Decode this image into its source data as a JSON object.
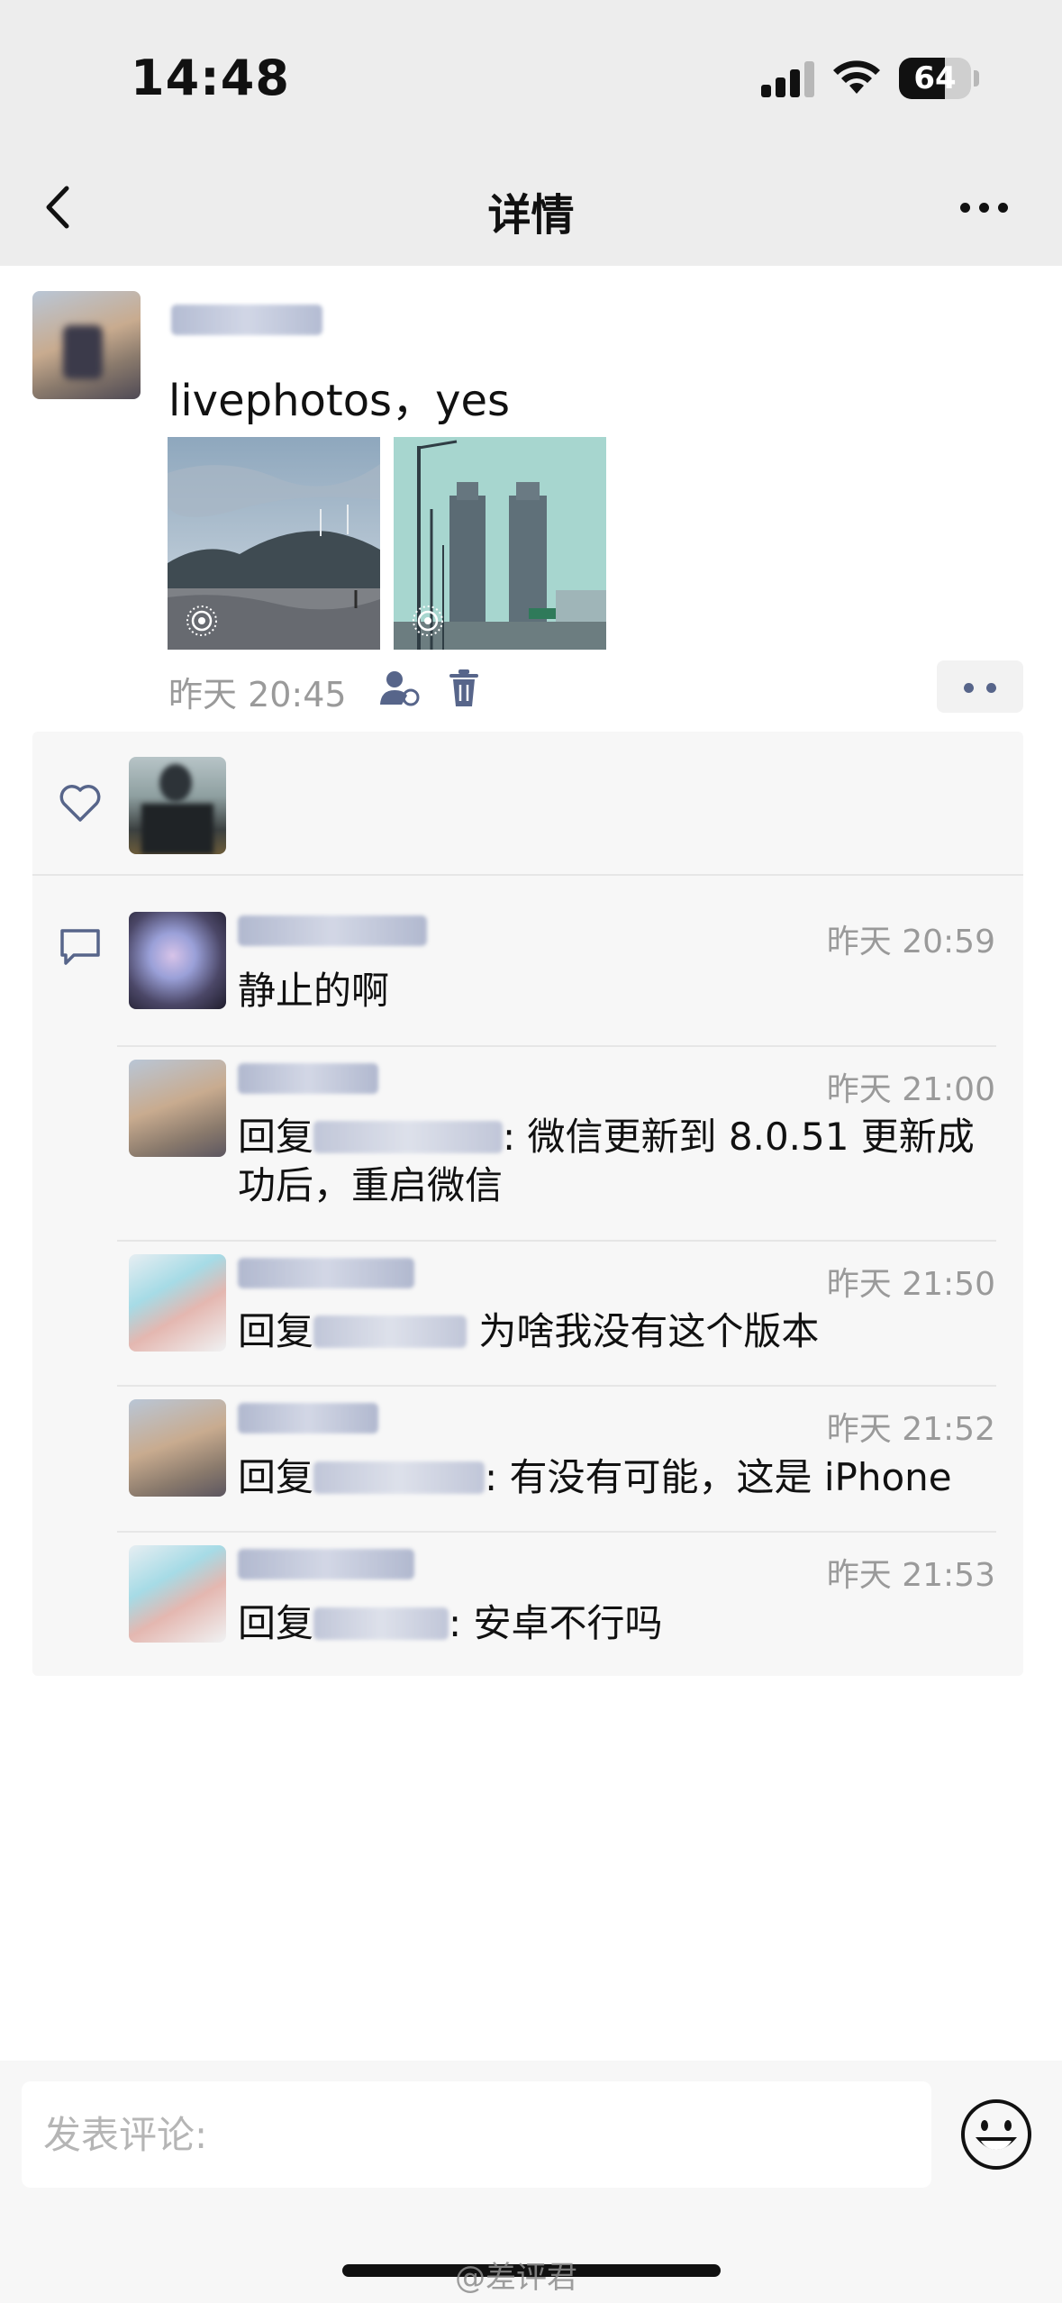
{
  "status_bar": {
    "time": "14:48",
    "battery": "64",
    "battery_level": 0.64
  },
  "nav": {
    "title": "详情"
  },
  "post": {
    "text": "livephotos，yes",
    "time": "昨天 20:45",
    "photos": [
      {
        "name": "seaside-photo",
        "icon": "live-photo-icon"
      },
      {
        "name": "towers-photo",
        "icon": "live-photo-icon"
      }
    ]
  },
  "comments": [
    {
      "time": "昨天 20:59",
      "prefix": "",
      "text": "静止的啊"
    },
    {
      "time": "昨天 21:00",
      "prefix": "回复",
      "text": ": 微信更新到 8.0.51 更新成功后，重启微信"
    },
    {
      "time": "昨天 21:50",
      "prefix": "回复",
      "text": " 为啥我没有这个版本"
    },
    {
      "time": "昨天 21:52",
      "prefix": "回复",
      "text": ": 有没有可能，这是 iPhone"
    },
    {
      "time": "昨天 21:53",
      "prefix": "回复",
      "text": ": 安卓不行吗"
    }
  ],
  "input": {
    "placeholder": "发表评论:"
  },
  "watermark": "@差评君",
  "icons": [
    "back-icon",
    "more-icon",
    "privacy-icon",
    "delete-icon",
    "like-icon",
    "comment-icon",
    "emoji-icon",
    "live-photo-icon"
  ]
}
